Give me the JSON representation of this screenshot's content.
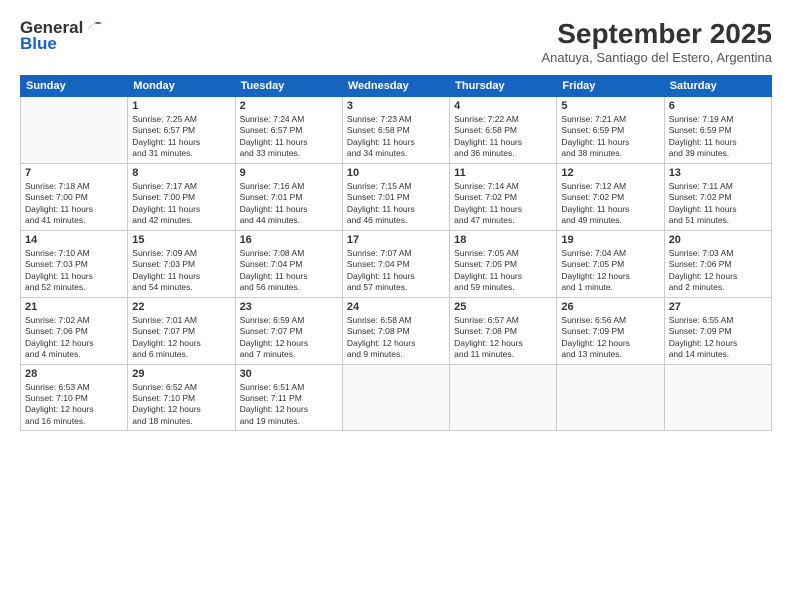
{
  "logo": {
    "general": "General",
    "blue": "Blue"
  },
  "header": {
    "month": "September 2025",
    "location": "Anatuya, Santiago del Estero, Argentina"
  },
  "days_of_week": [
    "Sunday",
    "Monday",
    "Tuesday",
    "Wednesday",
    "Thursday",
    "Friday",
    "Saturday"
  ],
  "weeks": [
    [
      {
        "day": "",
        "info": ""
      },
      {
        "day": "1",
        "info": "Sunrise: 7:25 AM\nSunset: 6:57 PM\nDaylight: 11 hours\nand 31 minutes."
      },
      {
        "day": "2",
        "info": "Sunrise: 7:24 AM\nSunset: 6:57 PM\nDaylight: 11 hours\nand 33 minutes."
      },
      {
        "day": "3",
        "info": "Sunrise: 7:23 AM\nSunset: 6:58 PM\nDaylight: 11 hours\nand 34 minutes."
      },
      {
        "day": "4",
        "info": "Sunrise: 7:22 AM\nSunset: 6:58 PM\nDaylight: 11 hours\nand 36 minutes."
      },
      {
        "day": "5",
        "info": "Sunrise: 7:21 AM\nSunset: 6:59 PM\nDaylight: 11 hours\nand 38 minutes."
      },
      {
        "day": "6",
        "info": "Sunrise: 7:19 AM\nSunset: 6:59 PM\nDaylight: 11 hours\nand 39 minutes."
      }
    ],
    [
      {
        "day": "7",
        "info": "Sunrise: 7:18 AM\nSunset: 7:00 PM\nDaylight: 11 hours\nand 41 minutes."
      },
      {
        "day": "8",
        "info": "Sunrise: 7:17 AM\nSunset: 7:00 PM\nDaylight: 11 hours\nand 42 minutes."
      },
      {
        "day": "9",
        "info": "Sunrise: 7:16 AM\nSunset: 7:01 PM\nDaylight: 11 hours\nand 44 minutes."
      },
      {
        "day": "10",
        "info": "Sunrise: 7:15 AM\nSunset: 7:01 PM\nDaylight: 11 hours\nand 46 minutes."
      },
      {
        "day": "11",
        "info": "Sunrise: 7:14 AM\nSunset: 7:02 PM\nDaylight: 11 hours\nand 47 minutes."
      },
      {
        "day": "12",
        "info": "Sunrise: 7:12 AM\nSunset: 7:02 PM\nDaylight: 11 hours\nand 49 minutes."
      },
      {
        "day": "13",
        "info": "Sunrise: 7:11 AM\nSunset: 7:02 PM\nDaylight: 11 hours\nand 51 minutes."
      }
    ],
    [
      {
        "day": "14",
        "info": "Sunrise: 7:10 AM\nSunset: 7:03 PM\nDaylight: 11 hours\nand 52 minutes."
      },
      {
        "day": "15",
        "info": "Sunrise: 7:09 AM\nSunset: 7:03 PM\nDaylight: 11 hours\nand 54 minutes."
      },
      {
        "day": "16",
        "info": "Sunrise: 7:08 AM\nSunset: 7:04 PM\nDaylight: 11 hours\nand 56 minutes."
      },
      {
        "day": "17",
        "info": "Sunrise: 7:07 AM\nSunset: 7:04 PM\nDaylight: 11 hours\nand 57 minutes."
      },
      {
        "day": "18",
        "info": "Sunrise: 7:05 AM\nSunset: 7:05 PM\nDaylight: 11 hours\nand 59 minutes."
      },
      {
        "day": "19",
        "info": "Sunrise: 7:04 AM\nSunset: 7:05 PM\nDaylight: 12 hours\nand 1 minute."
      },
      {
        "day": "20",
        "info": "Sunrise: 7:03 AM\nSunset: 7:06 PM\nDaylight: 12 hours\nand 2 minutes."
      }
    ],
    [
      {
        "day": "21",
        "info": "Sunrise: 7:02 AM\nSunset: 7:06 PM\nDaylight: 12 hours\nand 4 minutes."
      },
      {
        "day": "22",
        "info": "Sunrise: 7:01 AM\nSunset: 7:07 PM\nDaylight: 12 hours\nand 6 minutes."
      },
      {
        "day": "23",
        "info": "Sunrise: 6:59 AM\nSunset: 7:07 PM\nDaylight: 12 hours\nand 7 minutes."
      },
      {
        "day": "24",
        "info": "Sunrise: 6:58 AM\nSunset: 7:08 PM\nDaylight: 12 hours\nand 9 minutes."
      },
      {
        "day": "25",
        "info": "Sunrise: 6:57 AM\nSunset: 7:08 PM\nDaylight: 12 hours\nand 11 minutes."
      },
      {
        "day": "26",
        "info": "Sunrise: 6:56 AM\nSunset: 7:09 PM\nDaylight: 12 hours\nand 13 minutes."
      },
      {
        "day": "27",
        "info": "Sunrise: 6:55 AM\nSunset: 7:09 PM\nDaylight: 12 hours\nand 14 minutes."
      }
    ],
    [
      {
        "day": "28",
        "info": "Sunrise: 6:53 AM\nSunset: 7:10 PM\nDaylight: 12 hours\nand 16 minutes."
      },
      {
        "day": "29",
        "info": "Sunrise: 6:52 AM\nSunset: 7:10 PM\nDaylight: 12 hours\nand 18 minutes."
      },
      {
        "day": "30",
        "info": "Sunrise: 6:51 AM\nSunset: 7:11 PM\nDaylight: 12 hours\nand 19 minutes."
      },
      {
        "day": "",
        "info": ""
      },
      {
        "day": "",
        "info": ""
      },
      {
        "day": "",
        "info": ""
      },
      {
        "day": "",
        "info": ""
      }
    ]
  ]
}
